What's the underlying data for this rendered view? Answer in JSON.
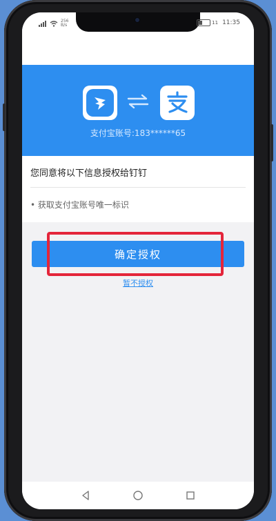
{
  "status_bar": {
    "network_speed": "256",
    "network_speed_unit": "B/s",
    "battery": "11",
    "time": "11:35"
  },
  "auth": {
    "account_label": "支付宝账号:183******65",
    "consent_text": "您同意将以下信息授权给钉钉",
    "permission_item": "• 获取支付宝账号唯一标识",
    "confirm_button": "确定授权",
    "decline_link": "暂不授权"
  },
  "icons": {
    "left_app": "dingtalk-logo-icon",
    "swap": "swap-arrows-icon",
    "right_app": "alipay-logo-icon"
  },
  "colors": {
    "primary": "#2d8ef0",
    "highlight_border": "#e4253a",
    "background": "#f2f2f4"
  }
}
